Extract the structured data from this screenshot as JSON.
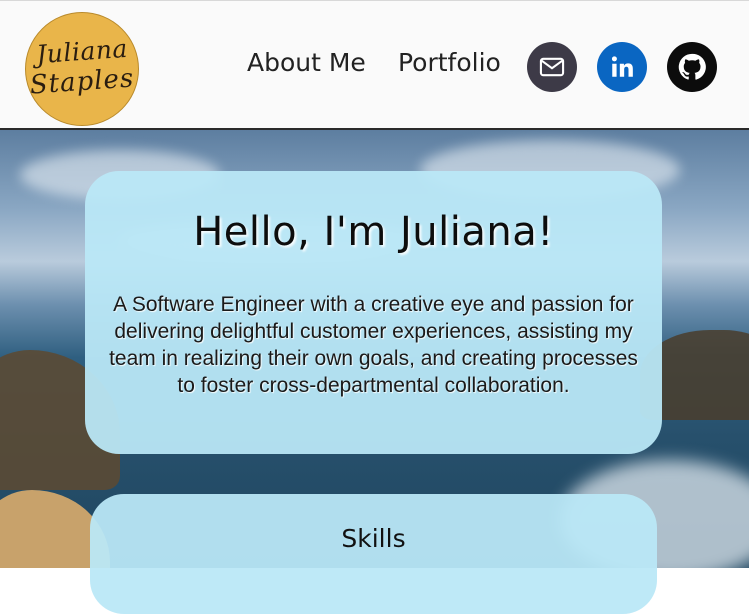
{
  "logo": {
    "line1": "Juliana",
    "line2": "Staples"
  },
  "nav": {
    "about_label": "About Me",
    "portfolio_label": "Portfolio"
  },
  "social": [
    {
      "name": "email",
      "icon": "mail-icon",
      "color": "#3d3a47"
    },
    {
      "name": "linkedin",
      "icon": "linkedin-icon",
      "color": "#0a66c2"
    },
    {
      "name": "github",
      "icon": "github-icon",
      "color": "#0c0c0c"
    }
  ],
  "hero": {
    "title": "Hello, I'm Juliana!",
    "description": "A Software Engineer with a creative eye and passion for delivering delightful customer experiences, assisting my team in realizing their own goals, and creating processes to foster cross-departmental collaboration."
  },
  "skills": {
    "heading": "Skills"
  },
  "colors": {
    "card_bg": "#bae8f7",
    "logo_bg": "#e9b54a",
    "header_border": "#2a2a2a"
  }
}
